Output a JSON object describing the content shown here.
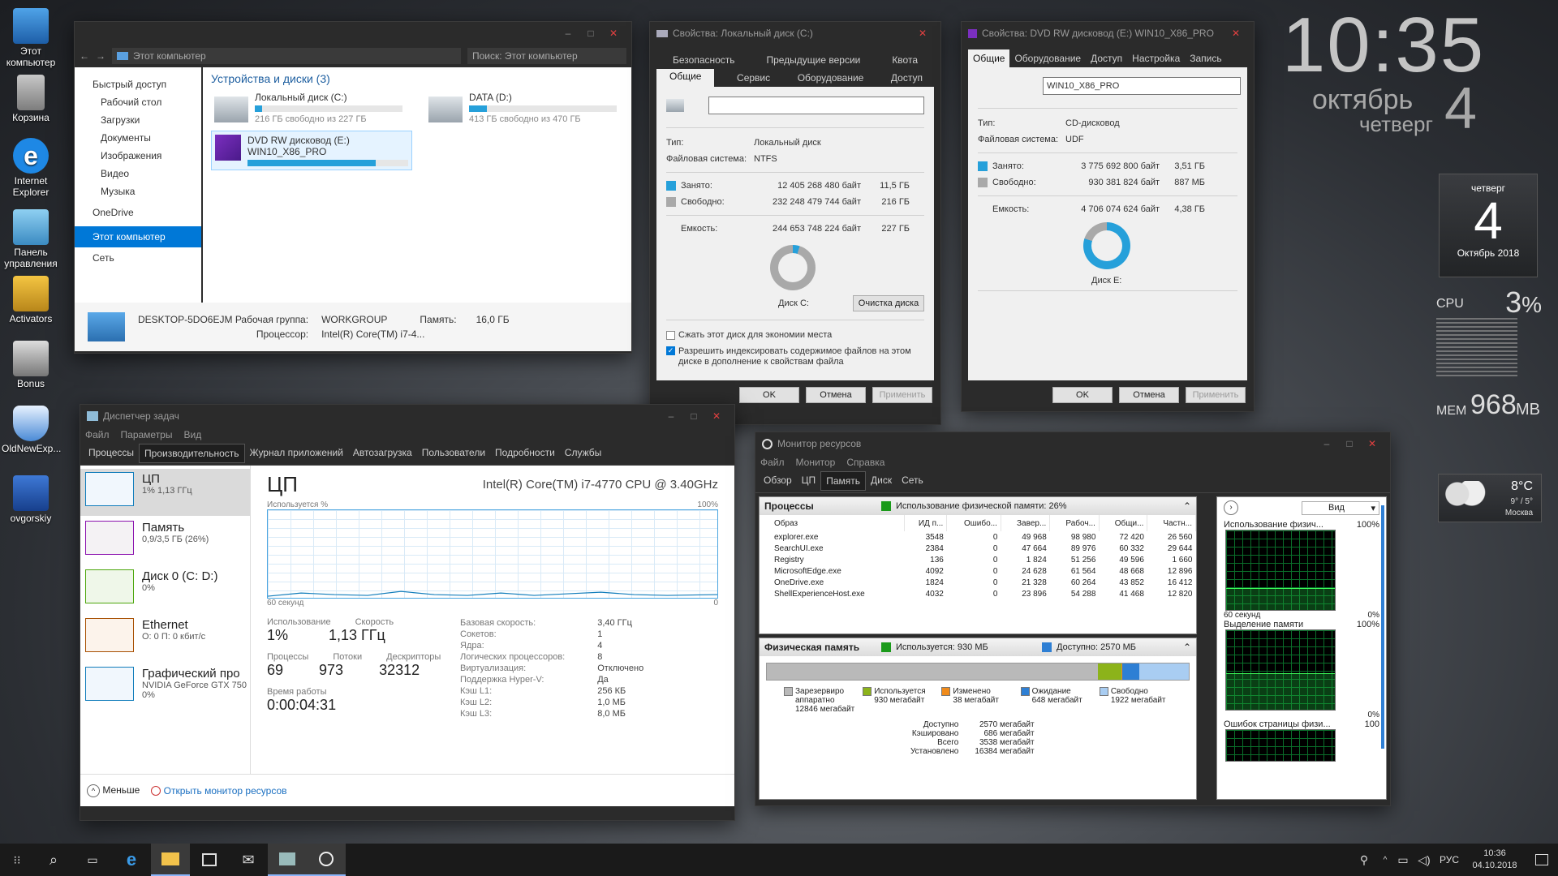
{
  "desktop": {
    "icons": [
      {
        "label": "Этот компьютер",
        "icon": "computer-icon"
      },
      {
        "label": "Корзина",
        "icon": "recycle-bin-icon"
      },
      {
        "label": "Internet Explorer",
        "icon": "ie-icon"
      },
      {
        "label": "Панель управления",
        "icon": "control-panel-icon"
      },
      {
        "label": "Activators",
        "icon": "key-folder-icon"
      },
      {
        "label": "Bonus",
        "icon": "bonus-icon"
      },
      {
        "label": "OldNewExp...",
        "icon": "shield-icon"
      },
      {
        "label": "ovgorskiy",
        "icon": "ovgorskiy-icon"
      }
    ]
  },
  "clock": {
    "time": "10:35",
    "month": "октябрь",
    "day": "4",
    "weekday": "четверг"
  },
  "calendar": {
    "weekday": "четверг",
    "day": "4",
    "month_year": "Октябрь 2018"
  },
  "gadgets": {
    "cpu_label": "CPU",
    "cpu_value": "3",
    "cpu_unit": "%",
    "mem_label": "MEM",
    "mem_value": "968",
    "mem_unit": "MB"
  },
  "weather": {
    "temp": "8°C",
    "range": "9° / 5°",
    "city": "Москва"
  },
  "explorer": {
    "address": "Этот компьютер",
    "search": "Поиск: Этот компьютер",
    "nav": [
      "Быстрый доступ",
      "Рабочий стол",
      "Загрузки",
      "Документы",
      "Изображения",
      "Видео",
      "Музыка",
      "OneDrive",
      "Этот компьютер",
      "Сеть"
    ],
    "section": "Устройства и диски (3)",
    "drives": [
      {
        "name": "Локальный диск (C:)",
        "free": "216 ГБ свободно из 227 ГБ",
        "fill": 0.05
      },
      {
        "name": "DATA (D:)",
        "free": "413 ГБ свободно из 470 ГБ",
        "fill": 0.12
      },
      {
        "name": "DVD RW дисковод (E:)",
        "sub": "WIN10_X86_PRO",
        "fill": 0.8
      }
    ],
    "footer": {
      "pc": "DESKTOP-5DO6EJM",
      "wg_label": "Рабочая группа:",
      "wg": "WORKGROUP",
      "mem_label": "Память:",
      "mem": "16,0 ГБ",
      "cpu_label": "Процессор:",
      "cpu": "Intel(R) Core(TM) i7-4..."
    }
  },
  "propC": {
    "title": "Свойства: Локальный диск (C:)",
    "tabs_top": [
      "Безопасность",
      "Предыдущие версии",
      "Квота"
    ],
    "tabs_bottom": [
      "Общие",
      "Сервис",
      "Оборудование",
      "Доступ"
    ],
    "type_label": "Тип:",
    "type": "Локальный диск",
    "fs_label": "Файловая система:",
    "fs": "NTFS",
    "used_label": "Занято:",
    "used_bytes": "12 405 268 480 байт",
    "used_gb": "11,5 ГБ",
    "free_label": "Свободно:",
    "free_bytes": "232 248 479 744 байт",
    "free_gb": "216 ГБ",
    "cap_label": "Емкость:",
    "cap_bytes": "244 653 748 224 байт",
    "cap_gb": "227 ГБ",
    "disk": "Диск C:",
    "cleanup": "Очистка диска",
    "used_fraction": 0.05,
    "compress": "Сжать этот диск для экономии места",
    "index": "Разрешить индексировать содержимое файлов на этом диске в дополнение к свойствам файла",
    "ok": "OK",
    "cancel": "Отмена",
    "apply": "Применить"
  },
  "propE": {
    "title": "Свойства: DVD RW дисковод (E:) WIN10_X86_PRO",
    "tabs": [
      "Общие",
      "Оборудование",
      "Доступ",
      "Настройка",
      "Запись"
    ],
    "label": "WIN10_X86_PRO",
    "type_label": "Тип:",
    "type": "CD-дисковод",
    "fs_label": "Файловая система:",
    "fs": "UDF",
    "used_label": "Занято:",
    "used_bytes": "3 775 692 800 байт",
    "used_gb": "3,51 ГБ",
    "free_label": "Свободно:",
    "free_bytes": "930 381 824 байт",
    "free_gb": "887 МБ",
    "cap_label": "Емкость:",
    "cap_bytes": "4 706 074 624 байт",
    "cap_gb": "4,38 ГБ",
    "disk": "Диск E:",
    "used_fraction": 0.8,
    "ok": "OK",
    "cancel": "Отмена",
    "apply": "Применить"
  },
  "taskmgr": {
    "title": "Диспетчер задач",
    "menu": [
      "Файл",
      "Параметры",
      "Вид"
    ],
    "tabs": [
      "Процессы",
      "Производительность",
      "Журнал приложений",
      "Автозагрузка",
      "Пользователи",
      "Подробности",
      "Службы"
    ],
    "side": [
      {
        "name": "ЦП",
        "sub": "1% 1,13 ГГц",
        "color": "#117dbb"
      },
      {
        "name": "Память",
        "sub": "0,9/3,5 ГБ (26%)",
        "color": "#8b12ae"
      },
      {
        "name": "Диск 0 (C: D:)",
        "sub": "0%",
        "color": "#4da60c"
      },
      {
        "name": "Ethernet",
        "sub": "О: 0 П: 0 кбит/с",
        "color": "#a74f01"
      },
      {
        "name": "Графический про",
        "sub": "NVIDIA GeForce GTX 750",
        "sub2": "0%",
        "color": "#117dbb"
      }
    ],
    "cpu_title": "ЦП",
    "cpu_model": "Intel(R) Core(TM) i7-4770 CPU @ 3.40GHz",
    "graph_label": "Используется %",
    "graph_max": "100%",
    "graph_time": "60 секунд",
    "graph_min": "0",
    "usage_label": "Использование",
    "usage": "1%",
    "speed_label": "Скорость",
    "speed": "1,13 ГГц",
    "proc_label": "Процессы",
    "proc": "69",
    "threads_label": "Потоки",
    "threads": "973",
    "handles_label": "Дескрипторы",
    "handles": "32312",
    "uptime_label": "Время работы",
    "uptime": "0:00:04:31",
    "specs": [
      [
        "Базовая скорость:",
        "3,40 ГГц"
      ],
      [
        "Сокетов:",
        "1"
      ],
      [
        "Ядра:",
        "4"
      ],
      [
        "Логических процессоров:",
        "8"
      ],
      [
        "Виртуализация:",
        "Отключено"
      ],
      [
        "Поддержка Hyper-V:",
        "Да"
      ],
      [
        "Кэш L1:",
        "256 КБ"
      ],
      [
        "Кэш L2:",
        "1,0 МБ"
      ],
      [
        "Кэш L3:",
        "8,0 МБ"
      ]
    ],
    "less": "Меньше",
    "open_rm": "Открыть монитор ресурсов"
  },
  "resmon": {
    "title": "Монитор ресурсов",
    "menu": [
      "Файл",
      "Монитор",
      "Справка"
    ],
    "tabs": [
      "Обзор",
      "ЦП",
      "Память",
      "Диск",
      "Сеть"
    ],
    "proc_header": "Процессы",
    "phys_mem_badge": "Использование физической памяти: 26%",
    "cols": [
      "Образ",
      "ИД п...",
      "Ошибо...",
      "Завер...",
      "Рабоч...",
      "Общи...",
      "Частн..."
    ],
    "rows": [
      [
        "explorer.exe",
        "3548",
        "0",
        "49 968",
        "98 980",
        "72 420",
        "26 560"
      ],
      [
        "SearchUI.exe",
        "2384",
        "0",
        "47 664",
        "89 976",
        "60 332",
        "29 644"
      ],
      [
        "Registry",
        "136",
        "0",
        "1 824",
        "51 256",
        "49 596",
        "1 660"
      ],
      [
        "MicrosoftEdge.exe",
        "4092",
        "0",
        "24 628",
        "61 564",
        "48 668",
        "12 896"
      ],
      [
        "OneDrive.exe",
        "1824",
        "0",
        "21 328",
        "60 264",
        "43 852",
        "16 412"
      ],
      [
        "ShellExperienceHost.exe",
        "4032",
        "0",
        "23 896",
        "54 288",
        "41 468",
        "12 820"
      ]
    ],
    "pm_header": "Физическая память",
    "pm_used": "Используется: 930 МБ",
    "pm_avail": "Доступно: 2570 МБ",
    "legend": [
      {
        "label": "Зарезервиро аппаратно",
        "val": "12846 мегабайт",
        "color": "#b9b9b9"
      },
      {
        "label": "Используется",
        "val": "930 мегабайт",
        "color": "#8cb31a"
      },
      {
        "label": "Изменено",
        "val": "38 мегабайт",
        "color": "#f08b1b"
      },
      {
        "label": "Ожидание",
        "val": "648 мегабайт",
        "color": "#2e7fd4"
      },
      {
        "label": "Свободно",
        "val": "1922 мегабайт",
        "color": "#a9cdf2"
      }
    ],
    "summary": [
      [
        "Доступно",
        "2570 мегабайт"
      ],
      [
        "Кэшировано",
        "686 мегабайт"
      ],
      [
        "Всего",
        "3538 мегабайт"
      ],
      [
        "Установлено",
        "16384 мегабайт"
      ]
    ],
    "view": "Вид",
    "graphs": [
      {
        "title": "Использование физич...",
        "max": "100%",
        "time": "60 секунд",
        "min": "0%"
      },
      {
        "title": "Выделение памяти",
        "max": "100%",
        "min": "0%"
      },
      {
        "title": "Ошибок страницы физи...",
        "max": "100"
      }
    ]
  },
  "taskbar": {
    "lang": "РУС",
    "time": "10:36",
    "date": "04.10.2018"
  }
}
